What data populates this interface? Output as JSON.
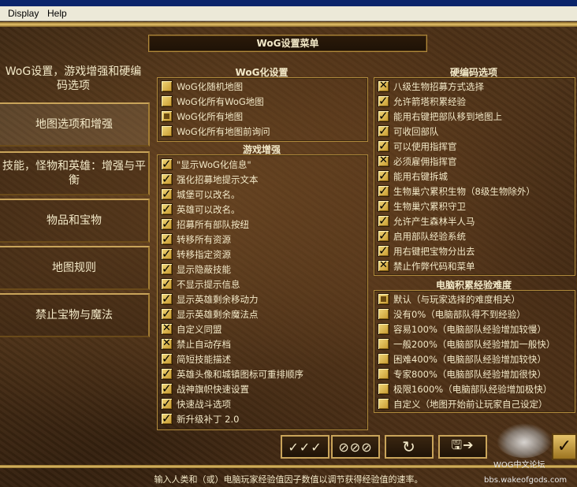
{
  "menubar": {
    "display": "Display",
    "help": "Help"
  },
  "title": "WoG设置菜单",
  "nav": {
    "heading": "WoG设置，游戏增强和硬编码选项",
    "items": [
      {
        "label": "地图选项和增强",
        "active": true
      },
      {
        "label": "技能，怪物和英雄：增强与平衡",
        "active": false
      },
      {
        "label": "物品和宝物",
        "active": false
      },
      {
        "label": "地图规则",
        "active": false
      },
      {
        "label": "禁止宝物与魔法",
        "active": false
      }
    ]
  },
  "wog_settings": {
    "title": "WoG化设置",
    "options": [
      {
        "label": "WoG化随机地图",
        "state": "off"
      },
      {
        "label": "WoG化所有WoG地图",
        "state": "off"
      },
      {
        "label": "WoG化所有地图",
        "state": "dot"
      },
      {
        "label": "WoG化所有地图前询问",
        "state": "off"
      }
    ]
  },
  "game_enhancements": {
    "title": "游戏增强",
    "options": [
      {
        "label": "\"显示WoG化信息\"",
        "state": "check"
      },
      {
        "label": "强化招募地提示文本",
        "state": "check"
      },
      {
        "label": "城堡可以改名。",
        "state": "check"
      },
      {
        "label": "英雄可以改名。",
        "state": "check"
      },
      {
        "label": "招募所有部队按纽",
        "state": "check"
      },
      {
        "label": "转移所有资源",
        "state": "check"
      },
      {
        "label": "转移指定资源",
        "state": "check"
      },
      {
        "label": "显示隐蔽技能",
        "state": "check"
      },
      {
        "label": "不显示提示信息",
        "state": "check"
      },
      {
        "label": "显示英雄剩余移动力",
        "state": "check"
      },
      {
        "label": "显示英雄剩余魔法点",
        "state": "check"
      },
      {
        "label": "自定义同盟",
        "state": "cross"
      },
      {
        "label": "禁止自动存档",
        "state": "cross"
      },
      {
        "label": "简短技能描述",
        "state": "check"
      },
      {
        "label": "英雄头像和城镇图标可重排顺序",
        "state": "check"
      },
      {
        "label": "战神旗帜快速设置",
        "state": "check"
      },
      {
        "label": "快速战斗选项",
        "state": "check"
      },
      {
        "label": "新升级补丁 2.0",
        "state": "check"
      }
    ]
  },
  "hardcoded": {
    "title": "硬编码选项",
    "options": [
      {
        "label": "八级生物招募方式选择",
        "state": "cross"
      },
      {
        "label": "允许箭塔积累经验",
        "state": "check"
      },
      {
        "label": "能用右键把部队移到地图上",
        "state": "check"
      },
      {
        "label": "可收回部队",
        "state": "check"
      },
      {
        "label": "可以使用指挥官",
        "state": "check"
      },
      {
        "label": "必须雇佣指挥官",
        "state": "cross"
      },
      {
        "label": "能用右键拆城",
        "state": "check"
      },
      {
        "label": "生物巢穴累积生物（8级生物除外）",
        "state": "check"
      },
      {
        "label": "生物巢穴累积守卫",
        "state": "check"
      },
      {
        "label": "允许产生森林半人马",
        "state": "check"
      },
      {
        "label": "启用部队经验系统",
        "state": "check"
      },
      {
        "label": "用右键把宝物分出去",
        "state": "check"
      },
      {
        "label": "禁止作弊代码和菜单",
        "state": "cross"
      }
    ]
  },
  "ai_difficulty": {
    "title": "电脑积累经验难度",
    "options": [
      {
        "label": "默认（与玩家选择的难度相关）",
        "state": "dot"
      },
      {
        "label": "没有0%（电脑部队得不到经验）",
        "state": "off"
      },
      {
        "label": "容易100%（电脑部队经验增加较慢）",
        "state": "off"
      },
      {
        "label": "一般200%（电脑部队经验增加一般快）",
        "state": "off"
      },
      {
        "label": "困难400%（电脑部队经验增加较快）",
        "state": "off"
      },
      {
        "label": "专家800%（电脑部队经验增加很快）",
        "state": "off"
      },
      {
        "label": "极限1600%（电脑部队经验增加极快）",
        "state": "off"
      },
      {
        "label": "自定义（地图开始前让玩家自己设定）",
        "state": "off"
      }
    ]
  },
  "buttons": {
    "select_all": "✓✓✓",
    "deselect_all": "⊘⊘⊘",
    "reset": "↻",
    "save": "🖫➔",
    "ok": "✓"
  },
  "status": "输入人类和（或）电脑玩家经验值因子数值以调节获得经验值的速率。",
  "watermark": {
    "line1": "WOG中文论坛",
    "line2": "bbs.wakeofgods.com"
  }
}
